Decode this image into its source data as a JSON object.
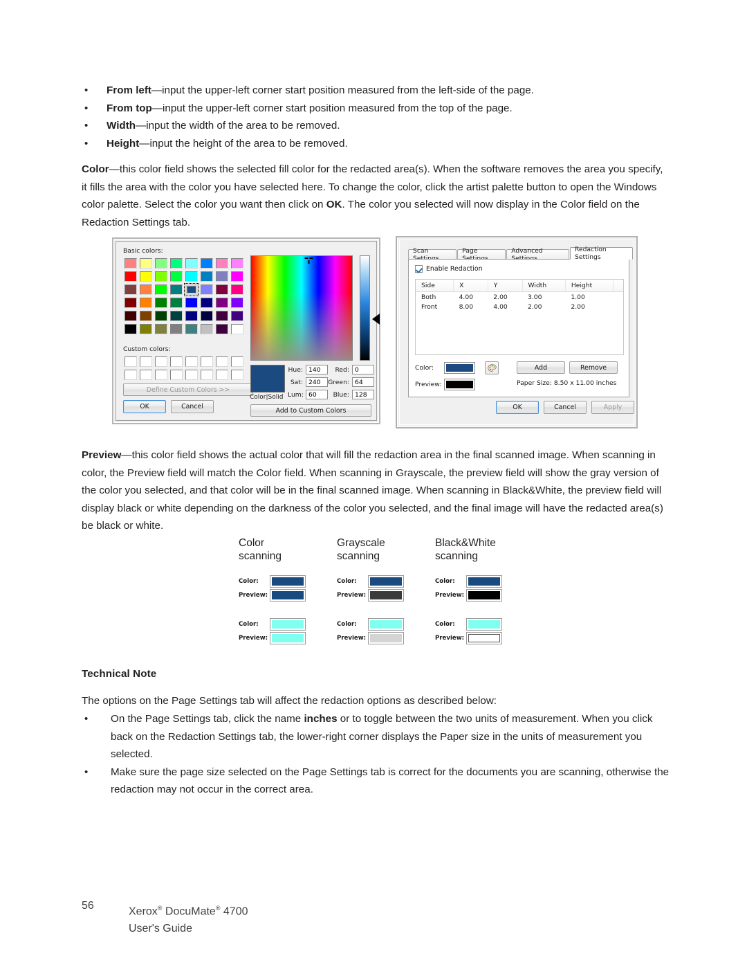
{
  "intro_bullets": [
    {
      "term": "From left",
      "rest": "—input the upper-left corner start position measured from the left-side of the page."
    },
    {
      "term": "From top",
      "rest": "—input the upper-left corner start position measured from the top of the page."
    },
    {
      "term": "Width",
      "rest": "—input the width of the area to be removed."
    },
    {
      "term": "Height",
      "rest": "—input the height of the area to be removed."
    }
  ],
  "color_paragraph": {
    "term": "Color",
    "part1": "—this color field shows the selected fill color for the redacted area(s). When the software removes the area you specify, it fills the area with the color you have selected here. To change the color, click the artist palette button to open the Windows color palette. Select the color you want then click on ",
    "bold2": "OK",
    "part2": ". The color you selected will now display in the Color field on the Redaction Settings tab."
  },
  "preview_paragraph": {
    "term": "Preview",
    "text": "—this color field shows the actual color that will fill the redaction area in the final scanned image. When scanning in color, the Preview field will match the Color field. When scanning in Grayscale, the preview field will show the gray version of the color you selected, and that color will be in the final scanned image. When scanning in Black&White, the preview field will display black or white depending on the darkness of the color you selected, and the final image will have the redacted area(s) be black or white."
  },
  "technical_note": {
    "heading": "Technical Note",
    "intro": "The options on the Page Settings tab will affect the redaction options as described below:",
    "bullets": [
      {
        "part1": "On the Page Settings tab, click the name ",
        "bold": "inches",
        "part2": " or  to toggle between the two units of measurement. When you click back on the Redaction Settings tab, the lower-right corner displays the Paper size in the units of measurement you selected."
      },
      {
        "part1": "Make sure the page size selected on the Page Settings tab is correct for the documents you are scanning, otherwise the redaction may not occur in the correct area.",
        "bold": "",
        "part2": ""
      }
    ]
  },
  "footer": {
    "page_number": "56",
    "product_line": "Xerox",
    "product_line2": " DocuMate",
    "product_line3": " 4700",
    "guide": "User's Guide",
    "registered": "®"
  },
  "color_dialog": {
    "basic_colors_label": "Basic colors:",
    "custom_colors_label": "Custom colors:",
    "define_custom_label": "Define Custom Colors >>",
    "ok_label": "OK",
    "cancel_label": "Cancel",
    "add_to_custom_label": "Add to Custom Colors",
    "colorsolid_label": "Color|Solid",
    "selected_color": "#1a4a80",
    "fields": [
      {
        "name": "hue",
        "label": "Hue:",
        "value": "140"
      },
      {
        "name": "sat",
        "label": "Sat:",
        "value": "240"
      },
      {
        "name": "lum",
        "label": "Lum:",
        "value": "60"
      },
      {
        "name": "red",
        "label": "Red:",
        "value": "0"
      },
      {
        "name": "green",
        "label": "Green:",
        "value": "64"
      },
      {
        "name": "blue",
        "label": "Blue:",
        "value": "128"
      }
    ],
    "basic_colors": [
      "#ff8080",
      "#ffff80",
      "#80ff80",
      "#00ff80",
      "#80ffff",
      "#0080ff",
      "#ff80c0",
      "#ff80ff",
      "#ff0000",
      "#ffff00",
      "#80ff00",
      "#00ff40",
      "#00ffff",
      "#0080c0",
      "#8080c0",
      "#ff00ff",
      "#804040",
      "#ff8040",
      "#00ff00",
      "#008080",
      "#1a4a80",
      "#8080ff",
      "#800040",
      "#ff0080",
      "#800000",
      "#ff8000",
      "#008000",
      "#008040",
      "#0000ff",
      "#000080",
      "#800080",
      "#8000ff",
      "#400000",
      "#804000",
      "#004000",
      "#004040",
      "#000080",
      "#000040",
      "#400040",
      "#400080",
      "#000000",
      "#808000",
      "#808040",
      "#808080",
      "#408080",
      "#c0c0c0",
      "#400040",
      "#ffffff"
    ],
    "selected_index": 20,
    "custom_color_count": 16,
    "custom_color_value": "#ffffff"
  },
  "redaction_dialog": {
    "tabs": [
      {
        "label": "Scan Settings",
        "active": false
      },
      {
        "label": "Page Settings",
        "active": false
      },
      {
        "label": "Advanced Settings",
        "active": false
      },
      {
        "label": "Redaction Settings",
        "active": true
      }
    ],
    "enable_redaction_label": "Enable Redaction",
    "enable_redaction_checked": true,
    "table": {
      "headers": [
        "Side",
        "X",
        "Y",
        "Width",
        "Height"
      ],
      "rows": [
        [
          "Both",
          "4.00",
          "2.00",
          "3.00",
          "1.00"
        ],
        [
          "Front",
          "8.00",
          "4.00",
          "2.00",
          "2.00"
        ]
      ]
    },
    "color_label": "Color:",
    "color_value": "#1a4a80",
    "preview_label": "Preview:",
    "preview_value": "#000000",
    "palette_button_name": "artist-palette-icon",
    "add_label": "Add",
    "remove_label": "Remove",
    "paper_size_text": "Paper Size:  8.50 x 11.00 inches",
    "ok_label": "OK",
    "cancel_label": "Cancel",
    "apply_label": "Apply",
    "apply_disabled": true
  },
  "scan_comparison": {
    "columns": [
      {
        "title_line1": "Color",
        "title_line2": "scanning",
        "samples": [
          {
            "color_label": "Color:",
            "color_value": "#1a4a80",
            "preview_label": "Preview:",
            "preview_value": "#1a4a80"
          },
          {
            "color_label": "Color:",
            "color_value": "#7ffff0",
            "preview_label": "Preview:",
            "preview_value": "#7ffff0"
          }
        ]
      },
      {
        "title_line1": "Grayscale",
        "title_line2": "scanning",
        "samples": [
          {
            "color_label": "Color:",
            "color_value": "#1a4a80",
            "preview_label": "Preview:",
            "preview_value": "#3b3b3b"
          },
          {
            "color_label": "Color:",
            "color_value": "#7ffff0",
            "preview_label": "Preview:",
            "preview_value": "#d4d4d4"
          }
        ]
      },
      {
        "title_line1": "Black&White",
        "title_line2": "scanning",
        "samples": [
          {
            "color_label": "Color:",
            "color_value": "#1a4a80",
            "preview_label": "Preview:",
            "preview_value": "#000000"
          },
          {
            "color_label": "Color:",
            "color_value": "#7ffff0",
            "preview_label": "Preview:",
            "preview_value": "#ffffff"
          }
        ]
      }
    ]
  }
}
